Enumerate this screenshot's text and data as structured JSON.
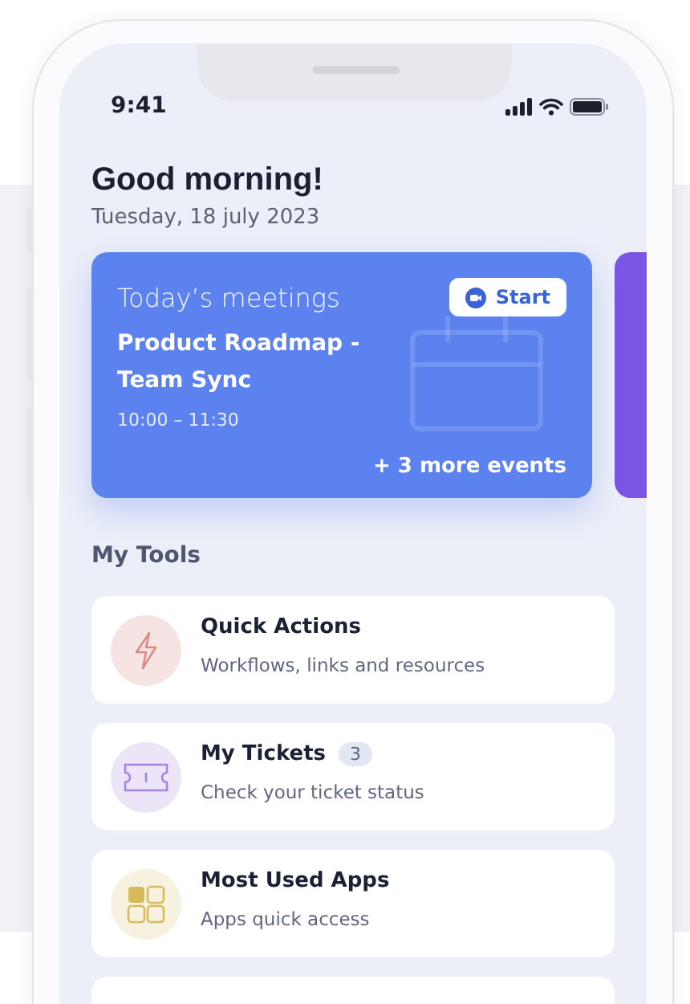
{
  "status_bar": {
    "time": "9:41"
  },
  "greeting": {
    "title": "Good morning!",
    "date": "Tuesday, 18 july 2023"
  },
  "meetings_card": {
    "title": "Today’s meetings",
    "start_button": "Start",
    "meeting": "Product Roadmap - Team Sync",
    "time": "10:00 – 11:30",
    "more": "+ 3 more events"
  },
  "tools": {
    "title": "My Tools",
    "items": [
      {
        "kind": "bolt",
        "color": "#f6e4e2",
        "title": "Quick Actions",
        "subtitle": "Workflows, links and resources"
      },
      {
        "kind": "ticket",
        "color": "#ece4f7",
        "title": "My Tickets",
        "badge": "3",
        "subtitle": "Check your ticket status"
      },
      {
        "kind": "grid",
        "color": "#f6f2df",
        "title": "Most Used Apps",
        "subtitle": "Apps quick access"
      }
    ]
  }
}
